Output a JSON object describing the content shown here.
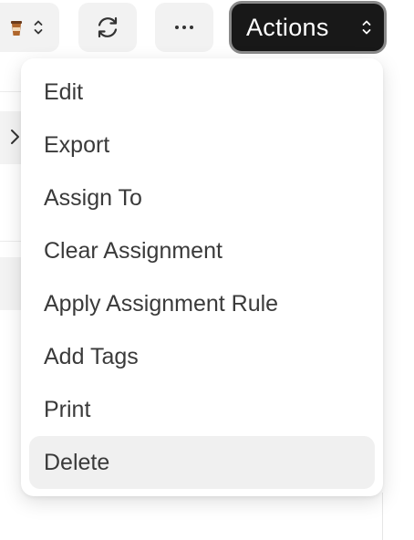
{
  "toolbar": {
    "select_icon": "coffee-icon",
    "select_caret_icon": "up-down-chevron-icon",
    "refresh_icon": "refresh-icon",
    "more_label": "···",
    "actions_label": "Actions",
    "actions_caret_icon": "up-down-chevron-icon"
  },
  "background": {
    "row_chevron_icon": "chevron-right-icon"
  },
  "menu": {
    "items": [
      {
        "label": "Edit"
      },
      {
        "label": "Export"
      },
      {
        "label": "Assign To"
      },
      {
        "label": "Clear Assignment"
      },
      {
        "label": "Apply Assignment Rule"
      },
      {
        "label": "Add Tags"
      },
      {
        "label": "Print"
      },
      {
        "label": "Delete",
        "highlighted": true
      }
    ]
  },
  "colors": {
    "actions_bg": "#181818",
    "button_bg": "#f2f2f2",
    "highlight_bg": "#f0f0f0"
  }
}
